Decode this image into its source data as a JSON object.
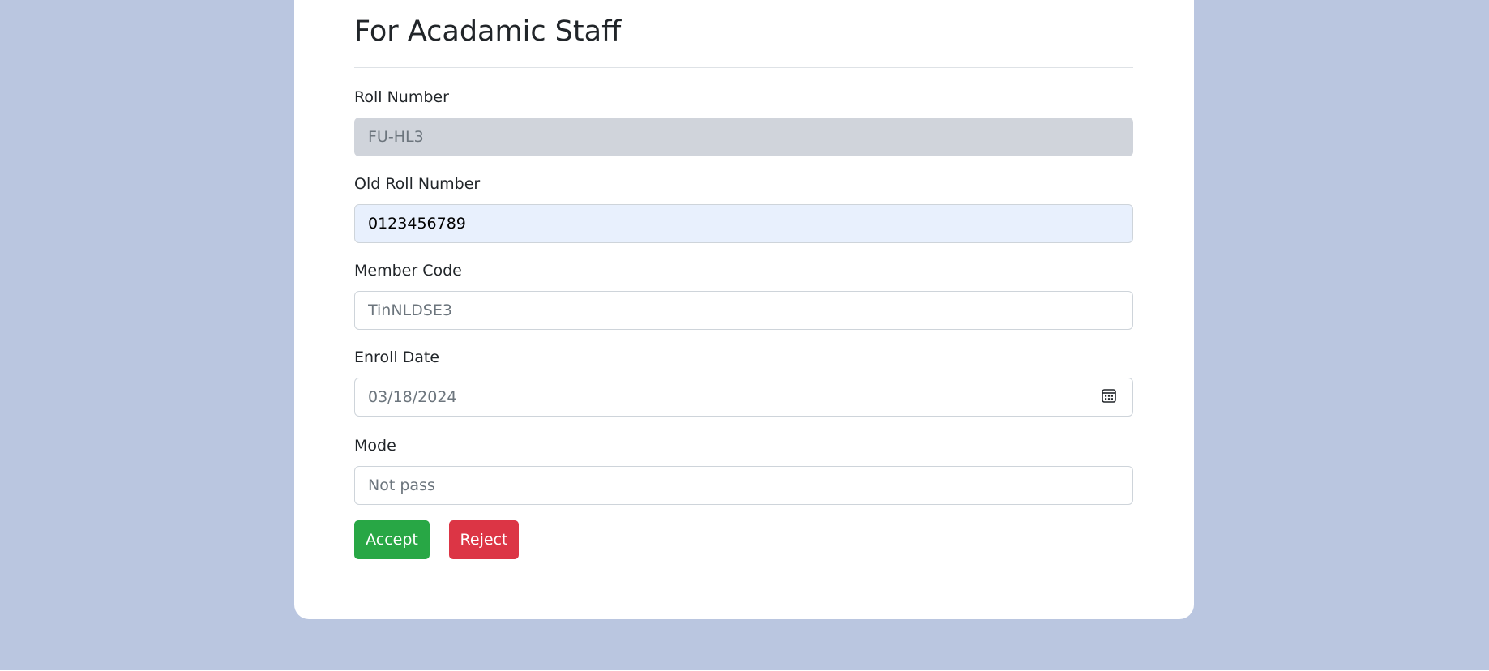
{
  "page": {
    "title": "For Acadamic Staff"
  },
  "form": {
    "roll_number": {
      "label": "Roll Number",
      "value": "FU-HL3"
    },
    "old_roll_number": {
      "label": "Old Roll Number",
      "value": "0123456789"
    },
    "member_code": {
      "label": "Member Code",
      "value": "TinNLDSE3"
    },
    "enroll_date": {
      "label": "Enroll Date",
      "value": "03/18/2024"
    },
    "mode": {
      "label": "Mode",
      "value": "Not pass"
    }
  },
  "actions": {
    "accept_label": "Accept",
    "reject_label": "Reject"
  },
  "icons": {
    "enroll_date_picker": "calendar-icon"
  },
  "colors": {
    "background": "#bac6e0",
    "accept": "#28a745",
    "reject": "#dc3545",
    "readonly_field": "#d0d4db",
    "autofill_field": "#e8f0fd"
  }
}
